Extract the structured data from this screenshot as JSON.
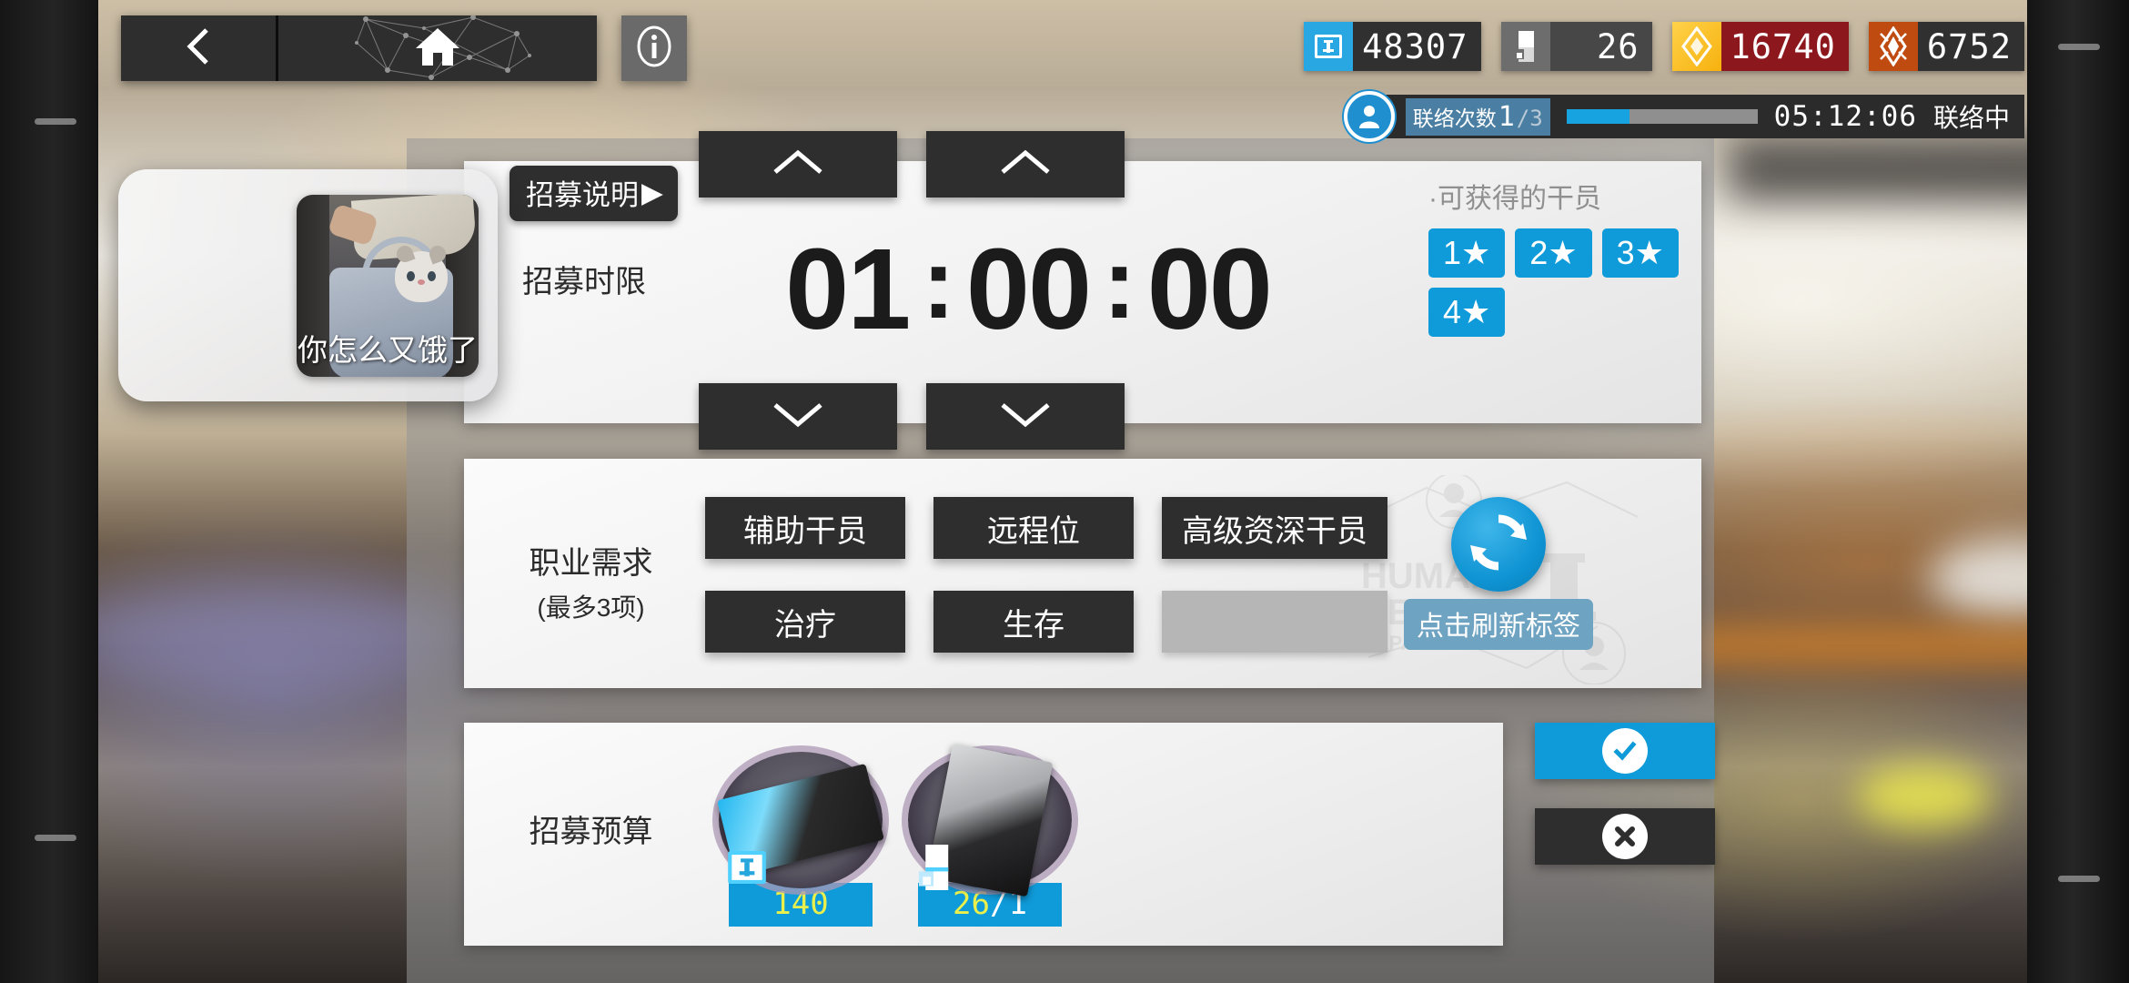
{
  "topbar": {
    "back_icon": "chevron-left-icon",
    "home_icon": "home-icon",
    "info_icon": "info-icon",
    "resources": [
      {
        "name": "recruit-permit",
        "icon": "recruit-ticket-icon",
        "value": "48307",
        "accent": "#29a7e3"
      },
      {
        "name": "expedited-plan",
        "icon": "expedited-plan-icon",
        "value": "26",
        "accent": "#6d6d6d"
      },
      {
        "name": "orundum",
        "icon": "orundum-icon",
        "value": "16740",
        "accent": "#f7b10e"
      },
      {
        "name": "originite-prime",
        "icon": "originite-prime-icon",
        "value": "6752",
        "accent": "#bf4b10"
      }
    ],
    "contact": {
      "label": "联络次数",
      "current": "1",
      "max": "/3",
      "progress_percent": 33,
      "timer": "05:12:06",
      "status": "联络中",
      "avatar_icon": "person-add-icon"
    }
  },
  "panel": {
    "hint_button": {
      "label": "招募说明",
      "arrow": "▶"
    },
    "time_card": {
      "label": "招募时限",
      "hours": "01",
      "minutes": "00",
      "seconds": "00",
      "separator": ":",
      "up_icon": "chevron-up-icon",
      "down_icon": "chevron-down-icon",
      "available": {
        "title": "·可获得的干员",
        "badges": [
          "1★",
          "2★",
          "3★",
          "4★"
        ],
        "accent": "#0f9ad9"
      }
    },
    "tags_card": {
      "label_line1": "职业需求",
      "label_line2": "(最多3项)",
      "tags": [
        {
          "label": "辅助干员",
          "empty": false
        },
        {
          "label": "远程位",
          "empty": false
        },
        {
          "label": "高级资深干员",
          "empty": false
        },
        {
          "label": "治疗",
          "empty": false
        },
        {
          "label": "生存",
          "empty": false
        },
        {
          "label": "",
          "empty": true
        }
      ],
      "refresh": {
        "icon": "refresh-icon",
        "tooltip": "点击刷新标签"
      },
      "watermark": "HUMAN RESOURCE DEPARTMENT"
    },
    "budget_card": {
      "label": "招募预算",
      "items": [
        {
          "name": "recruit-permit-item",
          "icon": "recruit-ticket-icon",
          "count": "140",
          "denominator": ""
        },
        {
          "name": "expedited-plan-item",
          "icon": "expedited-plan-icon",
          "count": "26",
          "denominator": "/1"
        }
      ]
    },
    "actions": {
      "confirm": {
        "icon": "check-circle-icon",
        "accent": "#0f9ad9"
      },
      "cancel": {
        "icon": "close-circle-icon",
        "accent": "#2e2e2e"
      }
    }
  },
  "call_overlay": {
    "mic_icon": "microphone-icon",
    "mic_color": "#21b24b",
    "camera_icon": "video-camera-icon",
    "camera_color": "#9a9a9a",
    "thumbnail_caption": "你怎么又饿了"
  }
}
